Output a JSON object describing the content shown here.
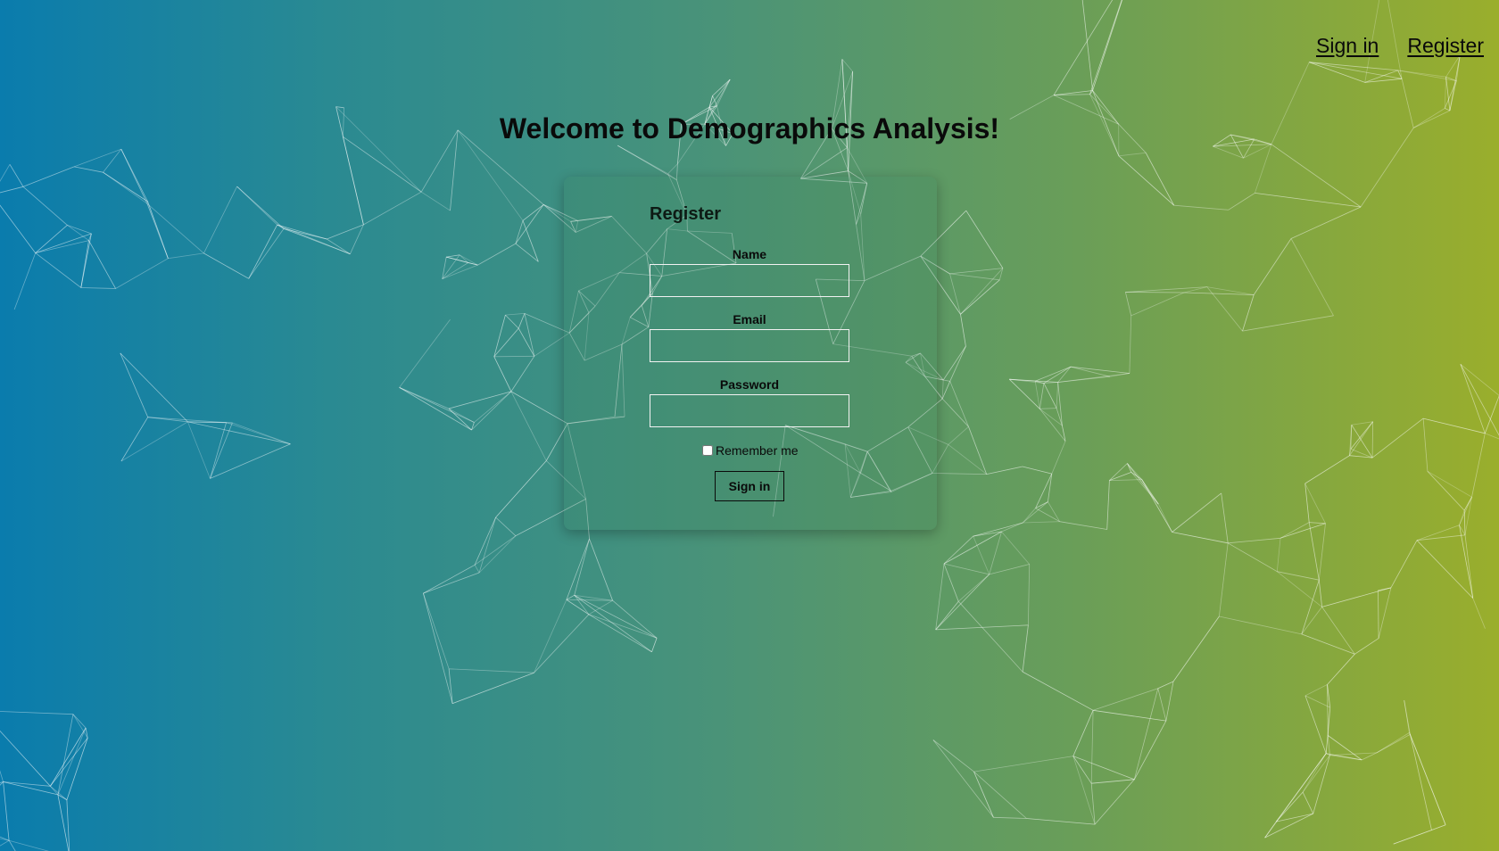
{
  "nav": {
    "sign_in": "Sign in",
    "register": "Register"
  },
  "page": {
    "title": "Welcome to Demographics Analysis!"
  },
  "form": {
    "title": "Register",
    "name_label": "Name",
    "name_value": "",
    "email_label": "Email",
    "email_value": "",
    "password_label": "Password",
    "password_value": "",
    "remember_label": "Remember me",
    "remember_checked": false,
    "submit_label": "Sign in"
  },
  "theme": {
    "gradient_left": "#0a7cad",
    "gradient_mid": "#4a9378",
    "gradient_right": "#9aae2c",
    "mesh_line": "#ffffff",
    "text": "#0a0a0a"
  }
}
